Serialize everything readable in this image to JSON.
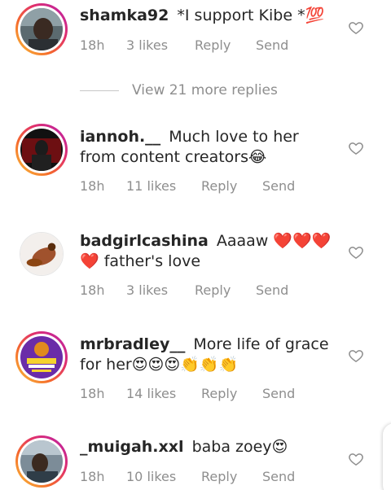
{
  "comments": [
    {
      "username": "shamka92",
      "text": "*I support Kibe *💯",
      "time": "18h",
      "likes": "3 likes",
      "reply_label": "Reply",
      "send_label": "Send"
    },
    {
      "username": "iannoh.__",
      "text": "Much love to her from content creators😂",
      "time": "18h",
      "likes": "11 likes",
      "reply_label": "Reply",
      "send_label": "Send"
    },
    {
      "username": "badgirlcashina",
      "text": "Aaaaw ❤️❤️❤️❤️ father's love",
      "time": "18h",
      "likes": "3 likes",
      "reply_label": "Reply",
      "send_label": "Send"
    },
    {
      "username": "mrbradley__",
      "text": "More life of grace for her😍😍😍👏👏👏",
      "time": "18h",
      "likes": "14 likes",
      "reply_label": "Reply",
      "send_label": "Send"
    },
    {
      "username": "_muigah.xxl",
      "text": "baba zoey😍",
      "time": "18h",
      "likes": "10 likes",
      "reply_label": "Reply",
      "send_label": "Send"
    }
  ],
  "view_more_replies": "View 21 more replies",
  "icons": {
    "like": "heart-outline-icon"
  },
  "colors": {
    "text": "#262626",
    "secondary": "#8e8e8e",
    "story_ring_start": "#f9c33a",
    "story_ring_end": "#b41fb0"
  }
}
